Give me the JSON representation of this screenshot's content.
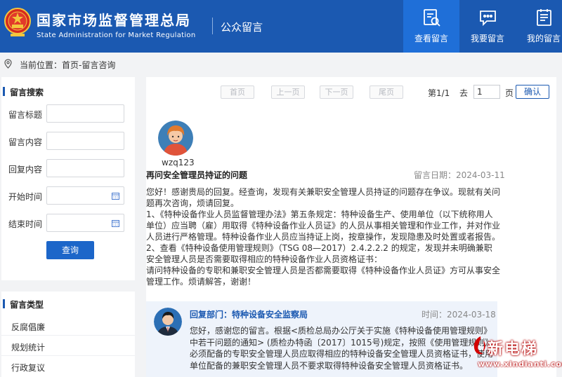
{
  "header": {
    "title_cn": "国家市场监督管理总局",
    "title_en": "State Administration for Market Regulation",
    "subtitle": "公众留言",
    "nav": [
      {
        "label": "查看留言",
        "icon": "view-message-icon",
        "active": true
      },
      {
        "label": "我要留言",
        "icon": "write-message-icon",
        "active": false
      },
      {
        "label": "我的留言",
        "icon": "my-message-icon",
        "active": false
      }
    ],
    "colors": {
      "brand": "#1b59b1",
      "active": "#1f6fd8"
    }
  },
  "breadcrumb": {
    "text": "当前位置：首页-留言咨询",
    "icon": "location-pin-icon"
  },
  "search": {
    "heading": "留言搜索",
    "fields": [
      {
        "label": "留言标题",
        "value": ""
      },
      {
        "label": "留言内容",
        "value": ""
      },
      {
        "label": "回复内容",
        "value": ""
      },
      {
        "label": "开始时间",
        "value": ""
      },
      {
        "label": "结束时间",
        "value": ""
      }
    ],
    "button": "查询"
  },
  "types": {
    "heading": "留言类型",
    "items": [
      "反腐倡廉",
      "规划统计",
      "行政复议"
    ]
  },
  "pagination": {
    "first": "首页",
    "prev": "上一页",
    "next": "下一页",
    "last": "尾页",
    "page_info": "第1/1",
    "goto_prefix": "去",
    "goto_value": "1",
    "goto_suffix": "页",
    "confirm": "确认"
  },
  "question": {
    "username": "wzq123",
    "title": "再问安全管理员持证的问题",
    "date": "留言日期：2024-03-11",
    "paragraphs": [
      "您好！感谢贵局的回复。经查询，发现有关兼职安全管理人员持证的问题存在争议。现就有关问题再次咨询，烦请回复。",
      "1、《特种设备作业人员监督管理办法》第五条规定：特种设备生产、使用单位（以下统称用人单位）应当聘（雇）用取得《特种设备作业人员证》的人员从事相关管理和作业工作，并对作业人员进行严格管理。特种设备作业人员应当持证上岗，按章操作，发现隐患及时处置或者报告。",
      "2、查看《特种设备使用管理规则》（TSG 08—2017）2.4.2.2.2 的规定，发现并未明确兼职安全管理人员是否需要取得相应的特种设备作业人员资格证书：",
      "请问特种设备的专职和兼职安全管理人员是否都需要取得《特种设备作业人员证》方可从事安全管理工作。烦请解答，谢谢！"
    ]
  },
  "reply": {
    "dept": "回复部门：特种设备安全监察局",
    "time": "时间：2024-03-18",
    "body": "您好，感谢您的留言。根据<质检总局办公厅关于实施《特种设备使用管理规则》中若干问题的通知> (质检办特函〔2017〕1015号)规定，按照《使用管理规则》必须配备的专职安全管理人员应取得相应的特种设备安全管理人员资格证书，使用单位配备的兼职安全管理人员不要求取得特种设备安全管理人员资格证书。"
  },
  "watermark": {
    "text": "新电梯",
    "url": "www.xindianti.com"
  }
}
